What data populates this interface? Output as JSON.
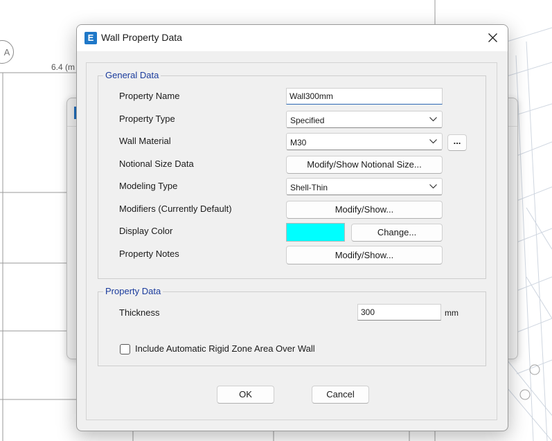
{
  "background": {
    "grid_label": "A",
    "dimension_label": "6.4 (m"
  },
  "dialog": {
    "icon_letter": "E",
    "title": "Wall Property Data",
    "close_icon": "close-icon"
  },
  "general_data": {
    "title": "General Data",
    "property_name": {
      "label": "Property Name",
      "value": "Wall300mm"
    },
    "property_type": {
      "label": "Property Type",
      "value": "Specified"
    },
    "wall_material": {
      "label": "Wall Material",
      "value": "M30",
      "browse_label": "..."
    },
    "notional_size": {
      "label": "Notional Size Data",
      "button": "Modify/Show Notional Size..."
    },
    "modeling_type": {
      "label": "Modeling Type",
      "value": "Shell-Thin"
    },
    "modifiers": {
      "label": "Modifiers (Currently Default)",
      "button": "Modify/Show..."
    },
    "display_color": {
      "label": "Display Color",
      "color": "#00FFFF",
      "button": "Change..."
    },
    "property_notes": {
      "label": "Property Notes",
      "button": "Modify/Show..."
    }
  },
  "property_data": {
    "title": "Property Data",
    "thickness": {
      "label": "Thickness",
      "value": "300",
      "unit": "mm"
    },
    "rigid_zone": {
      "label": "Include Automatic Rigid Zone Area Over Wall",
      "checked": false
    }
  },
  "buttons": {
    "ok": "OK",
    "cancel": "Cancel"
  }
}
